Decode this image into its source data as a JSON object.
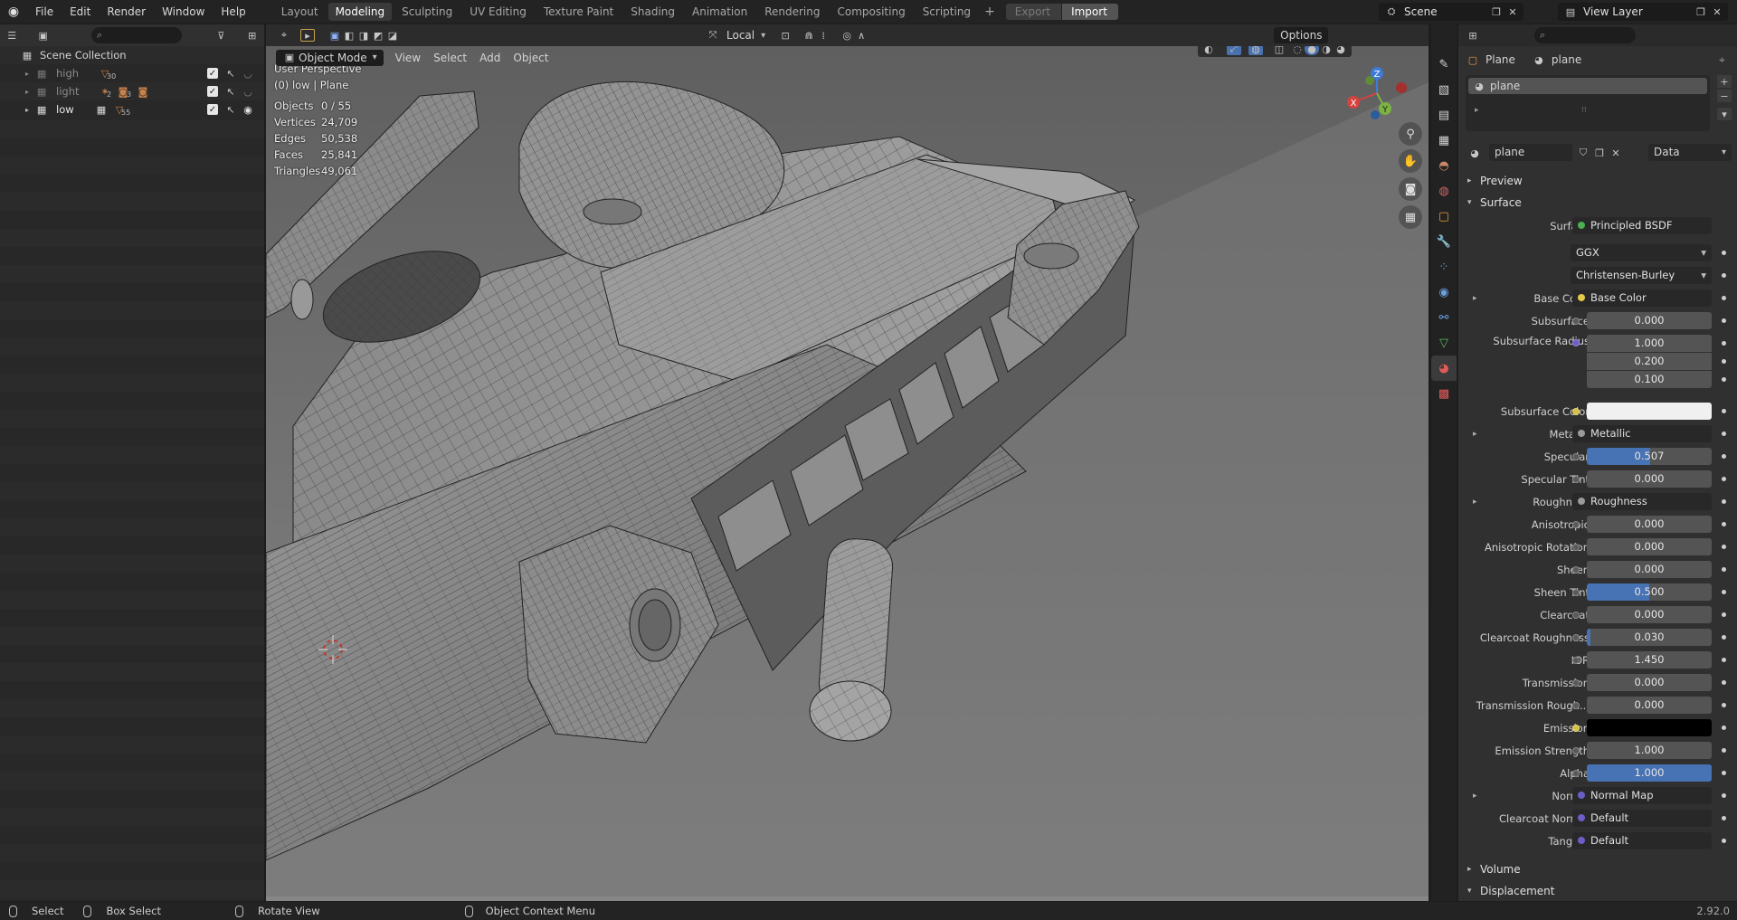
{
  "menus": [
    "File",
    "Edit",
    "Render",
    "Window",
    "Help"
  ],
  "workspace_tabs": [
    {
      "label": "Layout",
      "active": false
    },
    {
      "label": "Modeling",
      "active": true
    },
    {
      "label": "Sculpting",
      "active": false
    },
    {
      "label": "UV Editing",
      "active": false
    },
    {
      "label": "Texture Paint",
      "active": false
    },
    {
      "label": "Shading",
      "active": false
    },
    {
      "label": "Animation",
      "active": false
    },
    {
      "label": "Rendering",
      "active": false
    },
    {
      "label": "Compositing",
      "active": false
    },
    {
      "label": "Scripting",
      "active": false
    }
  ],
  "topbar": {
    "export_label": "Export",
    "import_label": "Import",
    "scene": "Scene",
    "view_layer": "View Layer"
  },
  "outliner": {
    "root": "Scene Collection",
    "collections": [
      {
        "name": "high",
        "count": "30",
        "visible": false
      },
      {
        "name": "light",
        "count": "2",
        "count2": "3",
        "visible": false
      },
      {
        "name": "low",
        "count": "55",
        "visible": true
      }
    ]
  },
  "viewport": {
    "mode": "Object Mode",
    "menus": [
      "View",
      "Select",
      "Add",
      "Object"
    ],
    "orientation": "Local",
    "options_label": "Options",
    "view_name": "User Perspective",
    "context": "(0) low | Plane",
    "stats": [
      {
        "k": "Objects",
        "v": "0 / 55"
      },
      {
        "k": "Vertices",
        "v": "24,709"
      },
      {
        "k": "Edges",
        "v": "50,538"
      },
      {
        "k": "Faces",
        "v": "25,841"
      },
      {
        "k": "Triangles",
        "v": "49,061"
      }
    ],
    "gizmo": {
      "x": "X",
      "y": "Y",
      "z": "Z"
    }
  },
  "properties": {
    "object": "Plane",
    "material": "plane",
    "slot": "plane",
    "datablock": "plane",
    "link": "Data",
    "sections": {
      "preview": "Preview",
      "surface": "Surface",
      "volume": "Volume",
      "displacement": "Displacement"
    },
    "surface_shader": "Principled BSDF",
    "distribution": "GGX",
    "subsurface_method": "Christensen-Burley",
    "rows": {
      "base_color": {
        "label": "Base Color",
        "value": "Base Color"
      },
      "subsurface": {
        "label": "Subsurface",
        "value": "0.000"
      },
      "subsurface_radius": {
        "label": "Subsurface Radius",
        "v1": "1.000",
        "v2": "0.200",
        "v3": "0.100"
      },
      "subsurface_color": {
        "label": "Subsurface Color"
      },
      "metallic": {
        "label": "Metallic",
        "value": "Metallic"
      },
      "specular": {
        "label": "Specular",
        "value": "0.507",
        "fill": 0.507
      },
      "specular_tint": {
        "label": "Specular Tint",
        "value": "0.000"
      },
      "roughness": {
        "label": "Roughness",
        "value": "Roughness"
      },
      "anisotropic": {
        "label": "Anisotropic",
        "value": "0.000"
      },
      "anisotropic_rotation": {
        "label": "Anisotropic Rotation",
        "value": "0.000"
      },
      "sheen": {
        "label": "Sheen",
        "value": "0.000"
      },
      "sheen_tint": {
        "label": "Sheen Tint",
        "value": "0.500",
        "fill": 0.5
      },
      "clearcoat": {
        "label": "Clearcoat",
        "value": "0.000"
      },
      "clearcoat_roughness": {
        "label": "Clearcoat Roughness",
        "value": "0.030",
        "fill": 0.03
      },
      "ior": {
        "label": "IOR",
        "value": "1.450"
      },
      "transmission": {
        "label": "Transmission",
        "value": "0.000"
      },
      "transmission_roughness": {
        "label": "Transmission Rough...",
        "value": "0.000"
      },
      "emission": {
        "label": "Emission"
      },
      "emission_strength": {
        "label": "Emission Strength",
        "value": "1.000"
      },
      "alpha": {
        "label": "Alpha",
        "value": "1.000",
        "fill": 1.0
      },
      "normal": {
        "label": "Normal",
        "value": "Normal Map"
      },
      "clearcoat_normal": {
        "label": "Clearcoat Normal",
        "value": "Default"
      },
      "tangent": {
        "label": "Tangent",
        "value": "Default"
      }
    },
    "surface_label": "Surface"
  },
  "statusbar": {
    "select": "Select",
    "box_select": "Box Select",
    "rotate": "Rotate View",
    "context_menu": "Object Context Menu",
    "version": "2.92.0"
  },
  "colors": {
    "accent": "#4772b3",
    "active_tab": "#3a3a3a",
    "background": "#1d1d1d",
    "viewport": "#6e6e6e"
  }
}
